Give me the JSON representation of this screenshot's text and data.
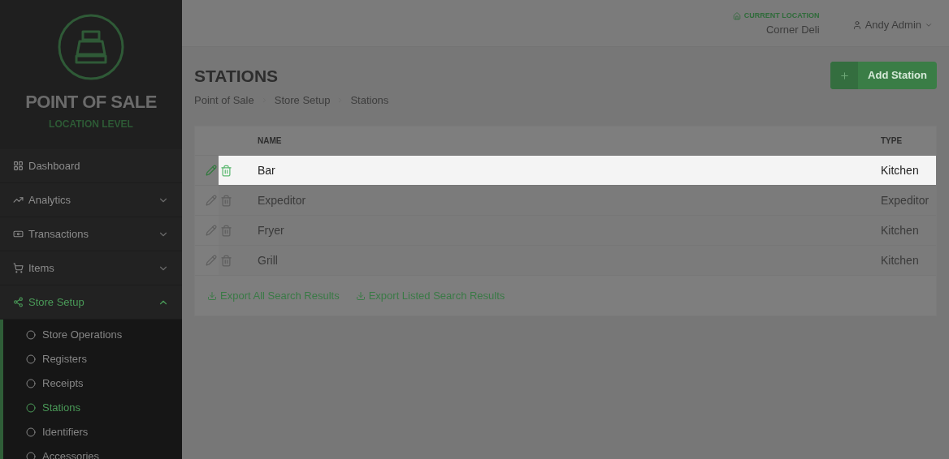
{
  "sidebar": {
    "app_title": "POINT OF SALE",
    "app_subtitle": "LOCATION LEVEL",
    "items": [
      {
        "label": "Dashboard",
        "selected": false
      },
      {
        "label": "Analytics",
        "selected": false,
        "expanded": false
      },
      {
        "label": "Transactions",
        "selected": false,
        "expanded": false
      },
      {
        "label": "Items",
        "selected": false,
        "expanded": false
      },
      {
        "label": "Store Setup",
        "selected": true,
        "expanded": true,
        "children": [
          {
            "label": "Store Operations",
            "selected": false
          },
          {
            "label": "Registers",
            "selected": false
          },
          {
            "label": "Receipts",
            "selected": false
          },
          {
            "label": "Stations",
            "selected": true
          },
          {
            "label": "Identifiers",
            "selected": false
          },
          {
            "label": "Accessories",
            "selected": false
          }
        ]
      }
    ]
  },
  "header": {
    "location_label": "CURRENT LOCATION",
    "location_name": "Corner Deli",
    "user": "Andy Admin"
  },
  "page": {
    "title": "STATIONS",
    "breadcrumbs": [
      "Point of Sale",
      "Store Setup",
      "Stations"
    ],
    "add_button": "Add Station"
  },
  "table": {
    "columns": [
      "NAME",
      "TYPE"
    ],
    "rows": [
      {
        "name": "Bar",
        "type": "Kitchen",
        "highlighted": true
      },
      {
        "name": "Expeditor",
        "type": "Expeditor",
        "highlighted": false
      },
      {
        "name": "Fryer",
        "type": "Kitchen",
        "highlighted": false
      },
      {
        "name": "Grill",
        "type": "Kitchen",
        "highlighted": false
      }
    ],
    "export_links": [
      "Export All Search Results",
      "Export Listed Search Results"
    ]
  }
}
